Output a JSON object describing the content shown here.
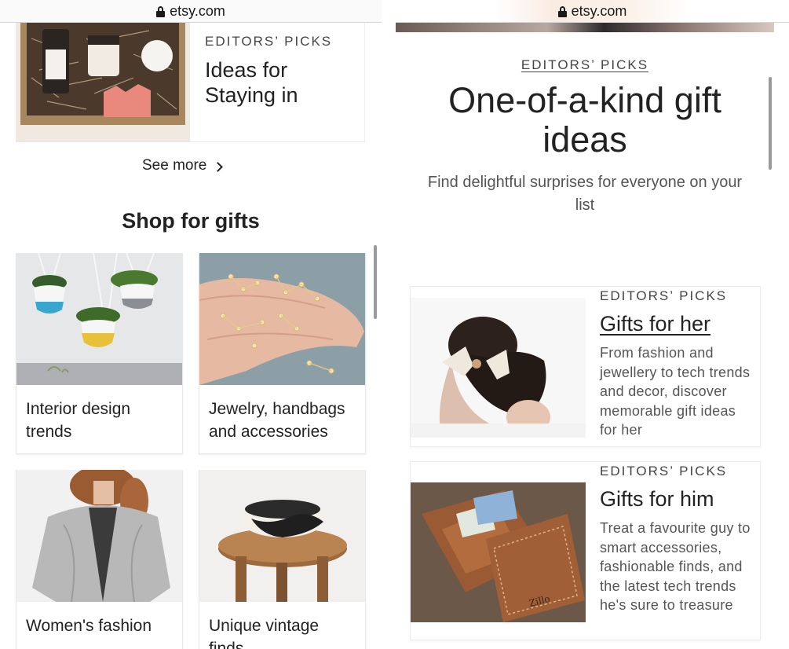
{
  "left": {
    "url": "etsy.com",
    "feature": {
      "eyebrow": "EDITORS’ PICKS",
      "title": "Ideas for Staying in"
    },
    "see_more": "See more",
    "section_title": "Shop for gifts",
    "cards": [
      {
        "label": "Interior design trends"
      },
      {
        "label": "Jewelry, handbags and accessories"
      },
      {
        "label": "Women's fashion"
      },
      {
        "label": "Unique vintage finds"
      }
    ]
  },
  "right": {
    "url": "etsy.com",
    "hero": {
      "eyebrow": "EDITORS’ PICKS",
      "title": "One-of-a-kind gift ideas",
      "subtitle": "Find delightful surprises for everyone on your list"
    },
    "picks": [
      {
        "eyebrow": "EDITORS’ PICKS",
        "title": "Gifts for her",
        "description": "From fashion and jewellery to tech trends and decor, discover memorable gift ideas for her"
      },
      {
        "eyebrow": "EDITORS’ PICKS",
        "title": "Gifts for him",
        "description": "Treat a favourite guy to smart accessories, fashionable finds, and the latest tech trends he's sure to treasure"
      }
    ]
  },
  "icons": [
    "lock-icon",
    "chevron-right-icon"
  ],
  "colors": {
    "text": "#222222",
    "muted": "#555555",
    "border": "#e9e9e9"
  }
}
